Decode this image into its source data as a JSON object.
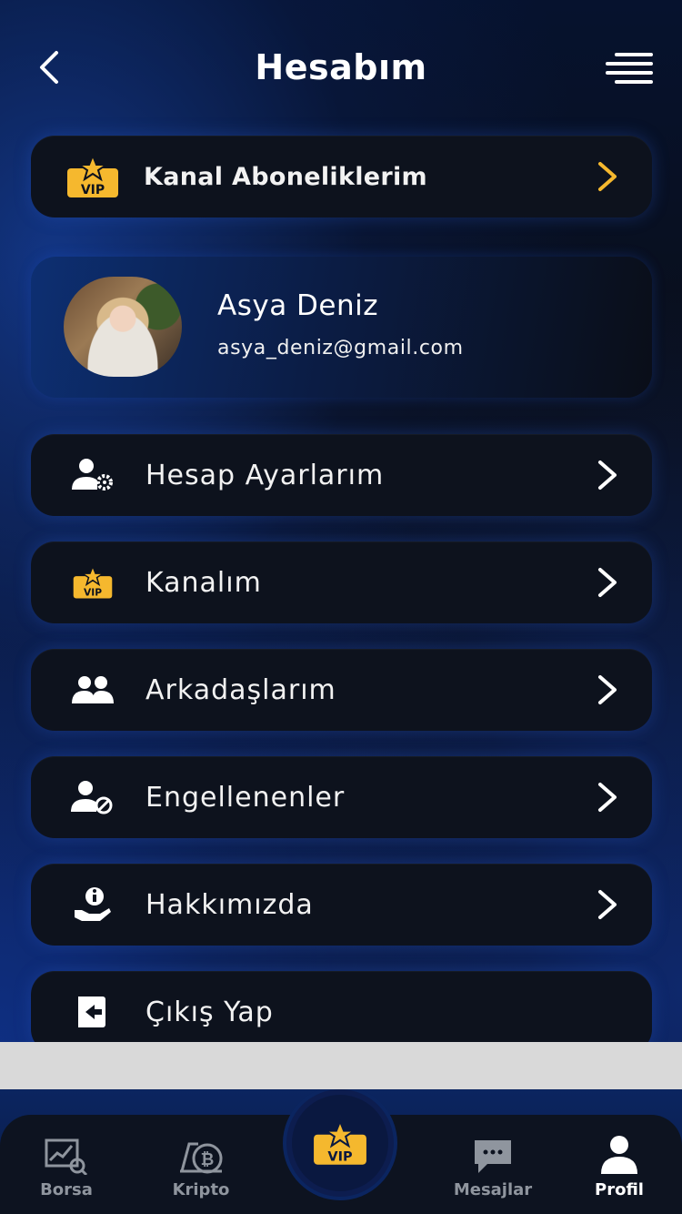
{
  "header": {
    "title": "Hesabım"
  },
  "vip_subscriptions": {
    "label": "Kanal Aboneliklerim",
    "badge_text": "VIP"
  },
  "profile": {
    "name": "Asya Deniz",
    "email": "asya_deniz@gmail.com"
  },
  "menu": [
    {
      "label": "Hesap Ayarlarım",
      "icon": "user-settings-icon"
    },
    {
      "label": "Kanalım",
      "icon": "vip-icon"
    },
    {
      "label": "Arkadaşlarım",
      "icon": "friends-icon"
    },
    {
      "label": "Engellenenler",
      "icon": "blocked-user-icon"
    },
    {
      "label": "Hakkımızda",
      "icon": "info-hand-icon"
    },
    {
      "label": "Çıkış Yap",
      "icon": "logout-icon"
    }
  ],
  "tabbar": {
    "tabs": [
      {
        "label": "Borsa",
        "icon": "stock-chart-icon"
      },
      {
        "label": "Kripto",
        "icon": "crypto-icon"
      },
      {
        "label": "Mesajlar",
        "icon": "chat-icon"
      },
      {
        "label": "Profil",
        "icon": "user-icon",
        "active": true
      }
    ],
    "center_badge": "VIP"
  },
  "colors": {
    "accent_gold": "#F5B82E",
    "text": "#FFFFFF",
    "inactive": "#8F959E"
  }
}
